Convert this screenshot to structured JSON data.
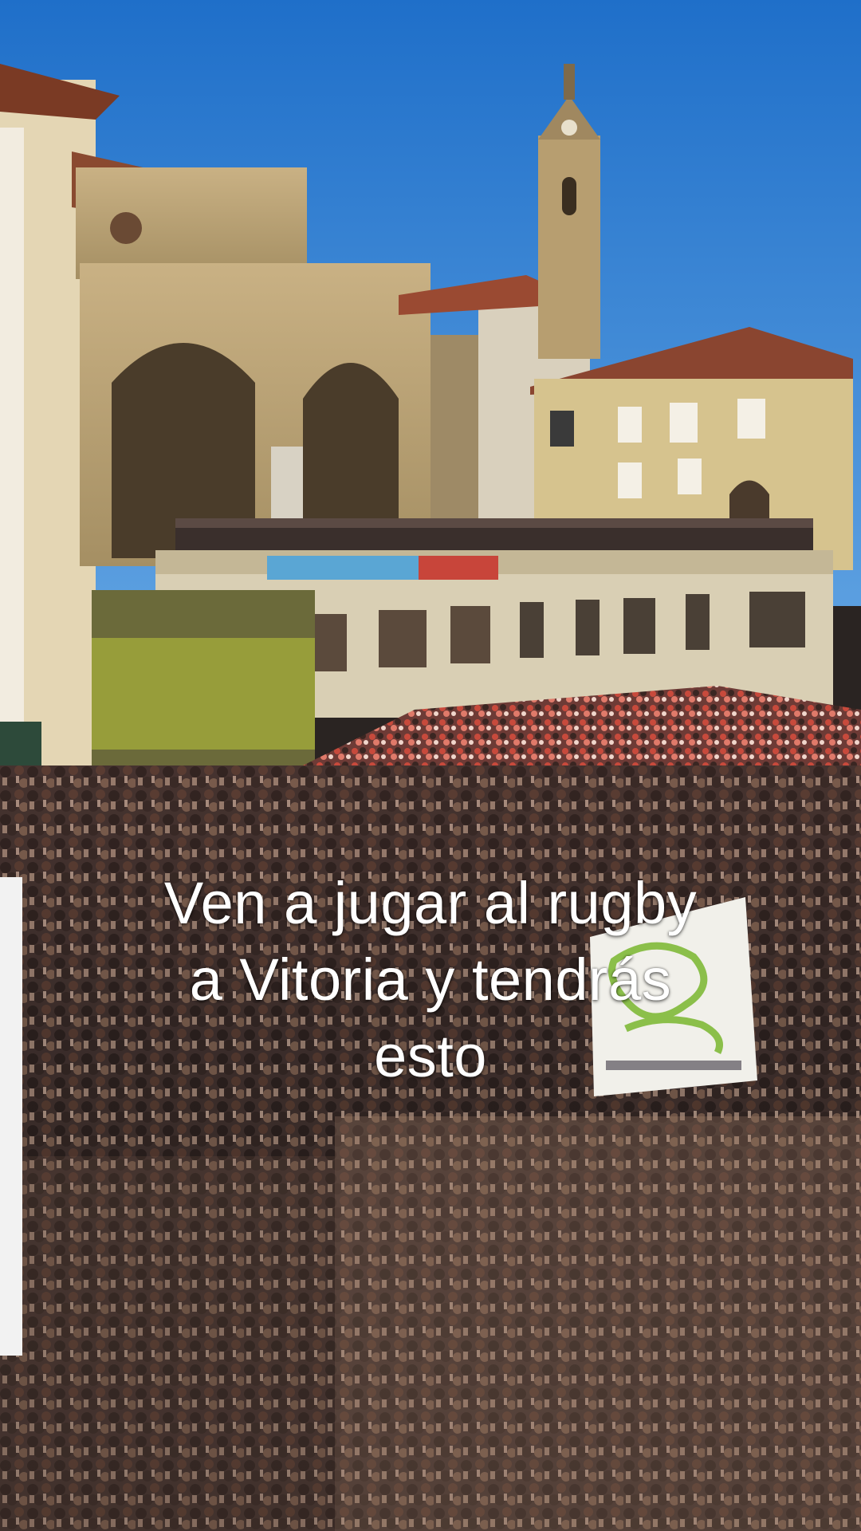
{
  "caption": {
    "line1": "Ven a jugar al rugby",
    "line2": "a Vitoria y tendrás",
    "line3": "esto"
  },
  "photo": {
    "sky_color": "#2f7fd0",
    "stone_color": "#c4aa78",
    "crowd_color": "#3a2c28",
    "festival_red": "#c8453a",
    "festival_green": "#b5c23a"
  }
}
